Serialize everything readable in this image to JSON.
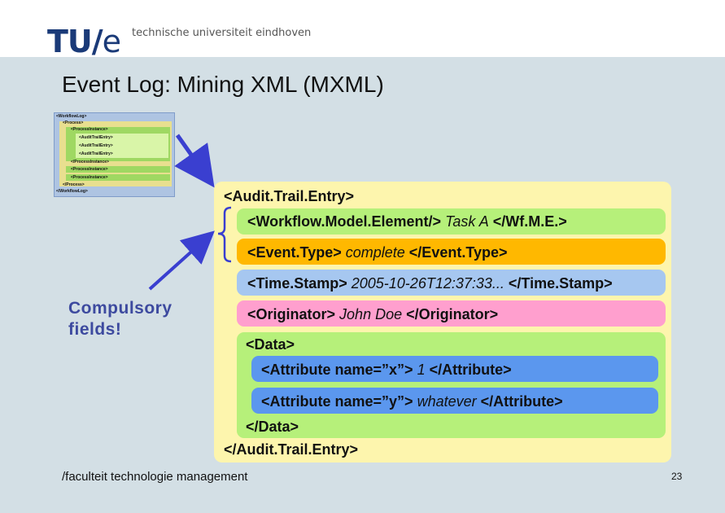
{
  "header": {
    "logo_text": "TU/e",
    "logo_tagline": "technische universiteit eindhoven"
  },
  "slide": {
    "title": "Event Log: Mining XML (MXML)",
    "annotation": "Compulsory fields!",
    "footer": "/faculteit technologie management",
    "page_number": "23"
  },
  "thumbnail": {
    "lines": [
      "<WorkflowLog>",
      "<Process>",
      "<ProcessInstance>",
      "<AuditTrailEntry>",
      "<AuditTrailEntry>",
      "<AuditTrailEntry>",
      "</ProcessInstance>",
      "<ProcessInstance>",
      "<ProcessInstance>",
      "</Process>",
      "</WorkflowLog>"
    ]
  },
  "audit_entry": {
    "open_tag": "<Audit.Trail.Entry>",
    "close_tag": "</Audit.Trail.Entry>",
    "wme_open": "<Workflow.Model.Element/>",
    "wme_value": "Task A",
    "wme_close": "</Wf.M.E.>",
    "event_open": "<Event.Type>",
    "event_value": "complete",
    "event_close": "</Event.Type>",
    "ts_open": "<Time.Stamp>",
    "ts_value": "2005-10-26T12:37:33...",
    "ts_close": "</Time.Stamp>",
    "orig_open": "<Originator>",
    "orig_value": "John Doe",
    "orig_close": "</Originator>",
    "data_open": "<Data>",
    "data_close": "</Data>",
    "attr1_open": "<Attribute name=”x”>",
    "attr1_value": "1",
    "attr1_close": "</Attribute>",
    "attr2_open": "<Attribute name=”y”>",
    "attr2_value": "whatever",
    "attr2_close": "</Attribute>"
  },
  "colors": {
    "wme_band": "#b6f07a",
    "event_band": "#ffb800",
    "timestamp_band": "#a6c7f0",
    "originator_band": "#ff9fce",
    "data_band": "#b6f07a",
    "attribute_band": "#5b97ee",
    "arrow": "#3a3fd0",
    "annotation": "#3d4a9f"
  }
}
